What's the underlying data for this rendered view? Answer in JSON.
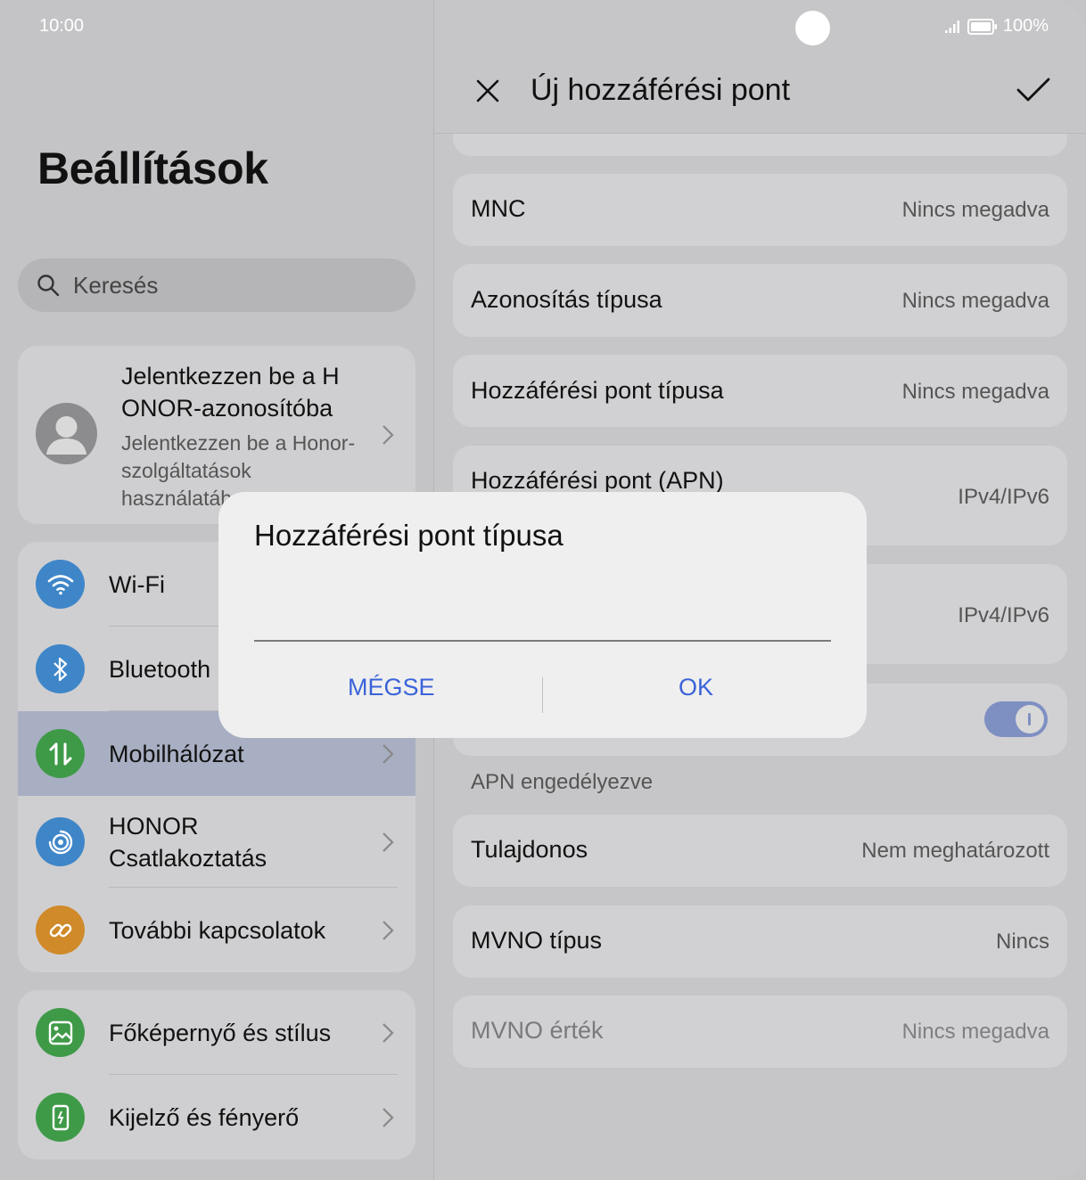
{
  "status_bar": {
    "time": "10:00",
    "battery": "100%"
  },
  "left": {
    "title": "Beállítások",
    "search_placeholder": "Keresés",
    "account": {
      "title": "Jelentkezzen be a H ONOR-azonosítóba",
      "subtitle": "Jelentkezzen be a Honor-szolgáltatások használatához"
    },
    "group1": [
      {
        "label": "Wi-Fi",
        "icon": "wifi-icon",
        "color": "#3f86c9"
      },
      {
        "label": "Bluetooth",
        "icon": "bluetooth-icon",
        "color": "#3f86c9"
      },
      {
        "label": "Mobilhálózat",
        "icon": "mobile-data-icon",
        "color": "#3f9a48"
      },
      {
        "label": "HONOR Csatlakoztatás",
        "icon": "honor-connect-icon",
        "color": "#3f86c9"
      },
      {
        "label": "További kapcsolatok",
        "icon": "link-icon",
        "color": "#d08a2a"
      }
    ],
    "group2": [
      {
        "label": "Főképernyő és stílus",
        "icon": "wallpaper-icon",
        "color": "#3f9a48"
      },
      {
        "label": "Kijelző és fényerő",
        "icon": "display-icon",
        "color": "#3f9a48"
      }
    ]
  },
  "right": {
    "header_title": "Új hozzáférési pont",
    "rows": [
      {
        "key": "MNC",
        "value": "Nincs megadva"
      },
      {
        "key": "Azonosítás típusa",
        "value": "Nincs megadva"
      },
      {
        "key": "Hozzáférési pont típusa",
        "value": "Nincs megadva"
      },
      {
        "key": "Hozzáférési pont (APN)",
        "value": "IPv4/IPv6"
      },
      {
        "key": "",
        "value": "IPv4/IPv6"
      }
    ],
    "section_label": "APN engedélyezve",
    "rows2": [
      {
        "key": "Tulajdonos",
        "value": "Nem meghatározott"
      },
      {
        "key": "MVNO típus",
        "value": "Nincs"
      },
      {
        "key": "MVNO érték",
        "value": "Nincs megadva"
      }
    ]
  },
  "dialog": {
    "title": "Hozzáférési pont típusa",
    "input_value": "",
    "cancel": "MÉGSE",
    "ok": "OK"
  },
  "colors": {
    "accent": "#3a63d9",
    "toggle_on": "#7e8fc2"
  }
}
